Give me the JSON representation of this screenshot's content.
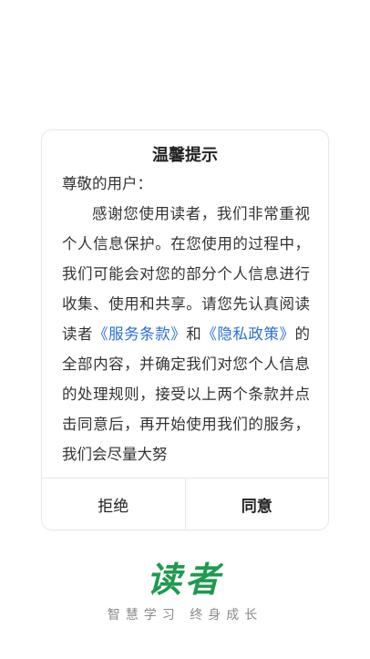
{
  "dialog": {
    "title": "温馨提示",
    "salutation": "尊敬的用户：",
    "text_part1": "感谢您使用读者，我们非常重视个人信息保护。在您使用的过程中，我们可能会对您的部分个人信息进行收集、使用和共享。请您先认真阅读读者",
    "link_terms": "《服务条款》",
    "text_and": "和",
    "link_privacy": "《隐私政策》",
    "text_part2": "的全部内容，并确定我们对您个人信息的处理规则，接受以上两个条款并点击同意后，再开始使用我们的服务，我们会尽量大努",
    "reject_label": "拒绝",
    "agree_label": "同意"
  },
  "brand": {
    "logo_text": "读者",
    "slogan": "智慧学习 终身成长"
  },
  "colors": {
    "link": "#2a6fd0",
    "logo": "#1f9a4f"
  }
}
